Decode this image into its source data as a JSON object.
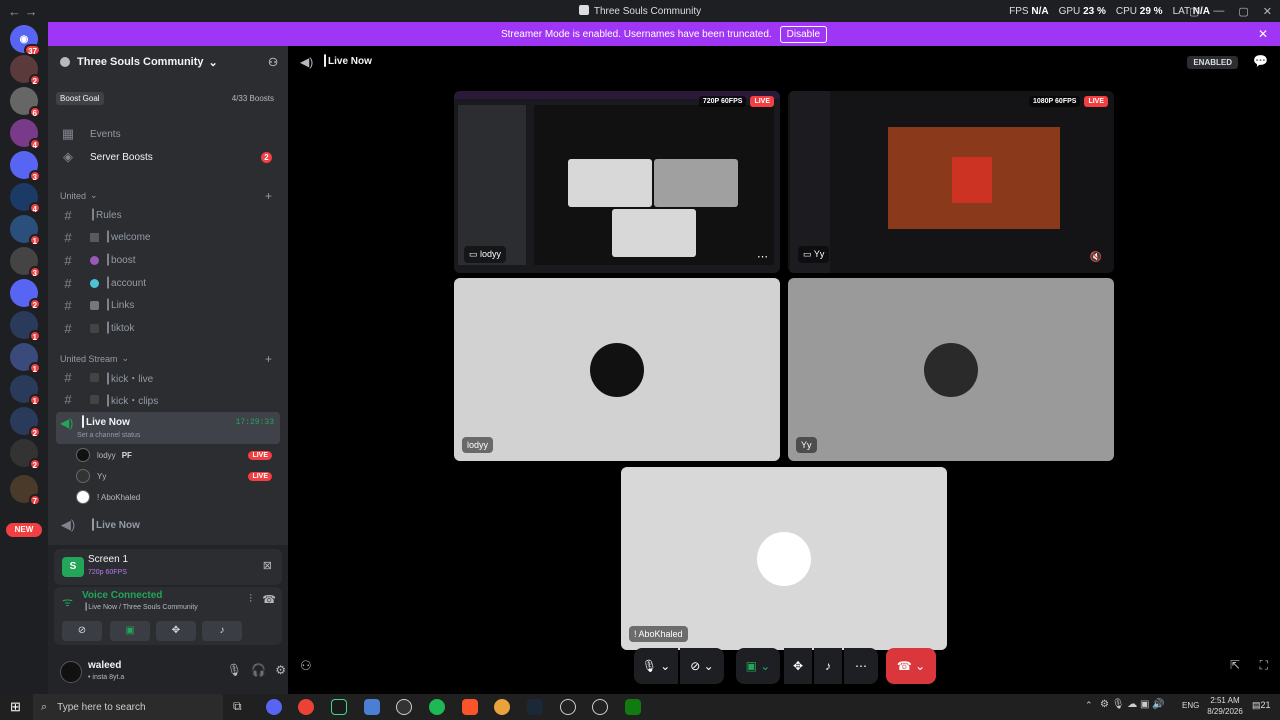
{
  "titlebar": {
    "title": "Three Souls Community",
    "back": "←",
    "forward": "→",
    "fps_label": "FPS",
    "fps": "N/A",
    "gpu_label": "GPU",
    "gpu": "23 %",
    "cpu_label": "CPU",
    "cpu": "29 %",
    "lat_label": "LAT",
    "lat": "N/A"
  },
  "banner": {
    "text": "Streamer Mode is enabled. Usernames have been truncated.",
    "button": "Disable"
  },
  "guilds": {
    "home_badge": "37",
    "badges": [
      "2",
      "6",
      "4",
      "3",
      "4",
      "1",
      "3",
      "2",
      "1",
      "1",
      "1",
      "2",
      "2",
      "7"
    ],
    "new_label": "NEW"
  },
  "server": {
    "name": "Three Souls Community"
  },
  "boost": {
    "label": "Boost Goal",
    "count": "4/33 Boosts"
  },
  "events": {
    "label": "Events"
  },
  "server_boosts": {
    "label": "Server Boosts",
    "badge": "2"
  },
  "cat1": {
    "label": "United"
  },
  "channels": [
    {
      "name": "┃Rules"
    },
    {
      "name": "┃welcome"
    },
    {
      "name": "┃boost"
    },
    {
      "name": "┃account"
    },
    {
      "name": "┃Links"
    },
    {
      "name": "┃tiktok"
    }
  ],
  "cat2": {
    "label": "United Stream"
  },
  "channels2": [
    {
      "name": "┃kick・live"
    },
    {
      "name": "┃kick・clips"
    }
  ],
  "voice_channel": {
    "name": "┃Live Now",
    "timer": "17:29:33",
    "status": "Set a channel status"
  },
  "voice_users": [
    {
      "name": "lodyy",
      "tag": "PF",
      "live": "LIVE"
    },
    {
      "name": "Yy",
      "live": "LIVE"
    },
    {
      "name": "! AboKhaled"
    }
  ],
  "voice_channel2": {
    "name": "┃Live Now"
  },
  "panel": {
    "screen_title": "Screen 1",
    "screen_sub": "720p 60FPS",
    "voice_status": "Voice Connected",
    "voice_loc": "┃Live Now / Three Souls Community",
    "user_name": "waleed",
    "user_status": "• insta 8yt.a"
  },
  "stage": {
    "channel_name": "┃Live Now",
    "enabled_label": "ENABLED"
  },
  "tiles": {
    "stream1": {
      "user": "lodyy",
      "res": "720P 60FPS",
      "live": "LIVE"
    },
    "stream2": {
      "user": "Yy",
      "res": "1080P 60FPS",
      "live": "LIVE"
    },
    "user1": {
      "name": "lodyy"
    },
    "user2": {
      "name": "Yy"
    },
    "user3": {
      "name": "! AboKhaled"
    }
  },
  "taskbar": {
    "search_placeholder": "Type here to search",
    "time": "2:51 AM",
    "date": "8/29/2026",
    "lang": "ENG",
    "notif": "21"
  },
  "colors": {
    "accent": "#a036f5",
    "live": "#f23f42",
    "green": "#23a55a",
    "discord": "#5865f2"
  }
}
